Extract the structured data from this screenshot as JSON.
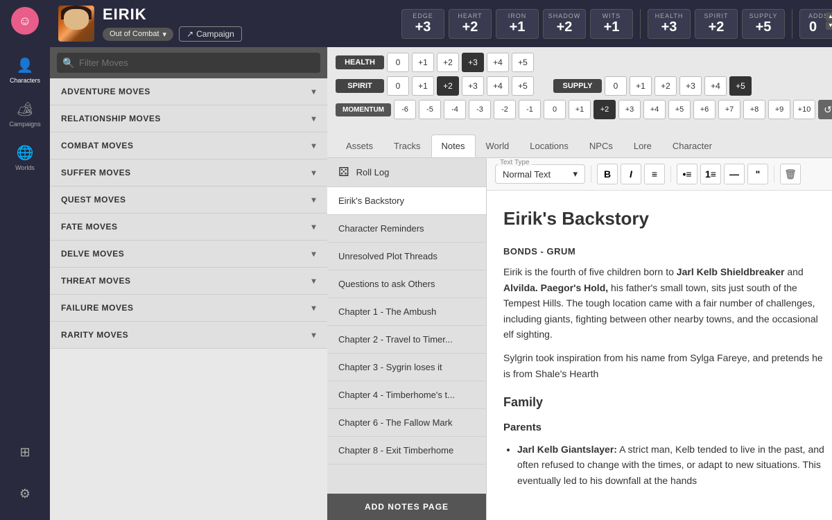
{
  "sidebar": {
    "logo": "☺",
    "nav_items": [
      {
        "id": "characters",
        "icon": "👤",
        "label": "Characters",
        "active": true
      },
      {
        "id": "campaigns",
        "icon": "🏕",
        "label": "Campaigns",
        "active": false
      },
      {
        "id": "worlds",
        "icon": "🌐",
        "label": "Worlds",
        "active": false
      }
    ],
    "bottom_items": [
      {
        "id": "grid",
        "icon": "⊞",
        "label": ""
      },
      {
        "id": "settings",
        "icon": "⚙",
        "label": ""
      }
    ]
  },
  "header": {
    "character_name": "EIRIK",
    "combat_status": "Out of Combat",
    "campaign_btn": "Campaign",
    "stats": [
      {
        "label": "EDGE",
        "value": "+3"
      },
      {
        "label": "HEART",
        "value": "+2"
      },
      {
        "label": "IRON",
        "value": "+1"
      },
      {
        "label": "SHADOW",
        "value": "+2"
      },
      {
        "label": "WITS",
        "value": "+1"
      }
    ],
    "meters": [
      {
        "label": "HEALTH",
        "value": "+3"
      },
      {
        "label": "SPIRIT",
        "value": "+2"
      },
      {
        "label": "SUPPLY",
        "value": "+5"
      }
    ],
    "adds": {
      "label": "ADDS",
      "value": "0"
    }
  },
  "tracks": {
    "health": {
      "label": "HEALTH",
      "cells": [
        0,
        1,
        2,
        3,
        4,
        5
      ],
      "active": 3
    },
    "spirit": {
      "label": "SPIRIT",
      "cells": [
        0,
        1,
        2,
        3,
        4,
        5
      ],
      "active": 2
    },
    "supply": {
      "label": "SUPPLY",
      "cells": [
        0,
        1,
        2,
        3,
        4,
        5
      ],
      "active": 5
    },
    "momentum": {
      "label": "MOMENTUM",
      "cells": [
        -6,
        -5,
        -4,
        -3,
        -2,
        -1,
        0,
        1,
        2,
        3,
        4,
        5,
        6,
        7,
        8,
        9,
        10
      ],
      "active": 2
    }
  },
  "tabs": [
    "Assets",
    "Tracks",
    "Notes",
    "World",
    "Locations",
    "NPCs",
    "Lore",
    "Character"
  ],
  "active_tab": "Notes",
  "moves": {
    "search_placeholder": "Filter Moves",
    "categories": [
      {
        "id": "adventure",
        "label": "ADVENTURE MOVES"
      },
      {
        "id": "relationship",
        "label": "RELATIONSHIP MOVES"
      },
      {
        "id": "combat",
        "label": "COMBAT MOVES"
      },
      {
        "id": "suffer",
        "label": "SUFFER MOVES"
      },
      {
        "id": "quest",
        "label": "QUEST MOVES"
      },
      {
        "id": "fate",
        "label": "FATE MOVES"
      },
      {
        "id": "delve",
        "label": "DELVE MOVES"
      },
      {
        "id": "threat",
        "label": "THREAT MOVES"
      },
      {
        "id": "failure",
        "label": "FAILURE MOVES"
      },
      {
        "id": "rarity",
        "label": "RARITY MOVES"
      }
    ]
  },
  "notes": {
    "pages": [
      {
        "id": "roll-log",
        "label": "Roll Log",
        "is_dice": true
      },
      {
        "id": "backstory",
        "label": "Eirik's Backstory",
        "active": true
      },
      {
        "id": "reminders",
        "label": "Character Reminders"
      },
      {
        "id": "plot-threads",
        "label": "Unresolved Plot Threads"
      },
      {
        "id": "questions",
        "label": "Questions to ask Others"
      },
      {
        "id": "ch1",
        "label": "Chapter 1 - The Ambush"
      },
      {
        "id": "ch2",
        "label": "Chapter 2 - Travel to Timer..."
      },
      {
        "id": "ch3",
        "label": "Chapter 3 - Sygrin loses it"
      },
      {
        "id": "ch4",
        "label": "Chapter 4 - Timberhome's t..."
      },
      {
        "id": "ch6",
        "label": "Chapter 6 - The Fallow Mark"
      },
      {
        "id": "ch8",
        "label": "Chapter 8 - Exit Timberhome"
      }
    ],
    "add_btn": "ADD NOTES PAGE"
  },
  "editor": {
    "text_type_label": "Text Type",
    "text_type": "Normal Text",
    "toolbar": {
      "bold": "B",
      "italic": "I",
      "align": "≡",
      "list_bullet": "•",
      "list_number": "1",
      "divider": "—",
      "quote": "❝",
      "delete": "🗑"
    },
    "content": {
      "title": "Eirik's Backstory",
      "section1_header": "BONDS - GRUM",
      "section1_body": "Eirik is the fourth of five children born to Jarl Kelb Shieldbreaker and Alvilda. Paegor's Hold, his father's small town, sits just south of the Tempest Hills. The tough location came with a fair number of challenges, including giants, fighting between other nearby towns, and the occasional elf sighting.",
      "section1_body2": "Sylgrin took inspiration from his name from Sylga Fareye, and pretends he is from Shale's Hearth",
      "section2_header": "Family",
      "section3_header": "Parents",
      "parent1_name": "Jarl Kelb Giantslayer:",
      "parent1_desc": "A strict man, Kelb tended to live in the past, and often refused to change with the times, or adapt to new situations. This eventually led to his downfall at the hands"
    }
  }
}
